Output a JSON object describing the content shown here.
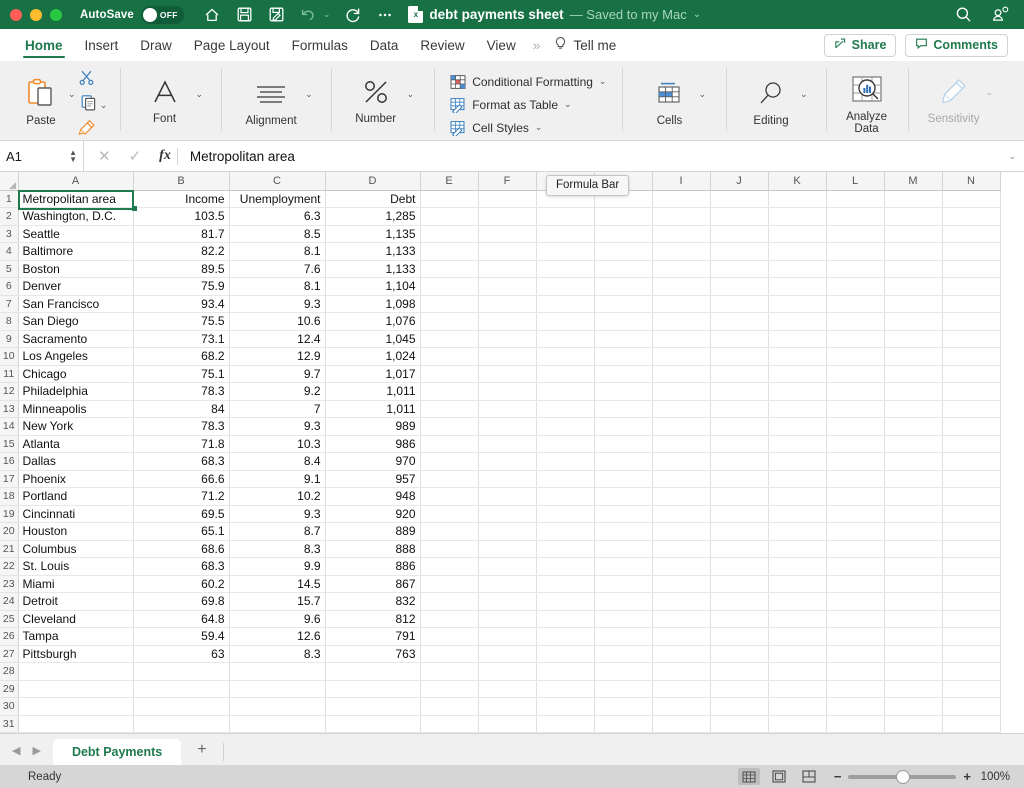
{
  "titlebar": {
    "autosave_label": "AutoSave",
    "autosave_state": "OFF",
    "doc_title": "debt payments sheet",
    "doc_status": "— Saved to my Mac",
    "icons": [
      "home-icon",
      "save-icon",
      "save-as-icon",
      "undo-icon",
      "redo-icon",
      "more-icon"
    ],
    "right_icons": [
      "search-icon",
      "collaborators-icon"
    ]
  },
  "ribbon_tabs": {
    "items": [
      {
        "label": "Home",
        "active": true
      },
      {
        "label": "Insert",
        "active": false
      },
      {
        "label": "Draw",
        "active": false
      },
      {
        "label": "Page Layout",
        "active": false
      },
      {
        "label": "Formulas",
        "active": false
      },
      {
        "label": "Data",
        "active": false
      },
      {
        "label": "Review",
        "active": false
      },
      {
        "label": "View",
        "active": false
      }
    ],
    "overflow": "»",
    "tell_me": "Tell me",
    "share_label": "Share",
    "comments_label": "Comments"
  },
  "ribbon": {
    "paste_label": "Paste",
    "font_label": "Font",
    "alignment_label": "Alignment",
    "number_label": "Number",
    "conditional_formatting_label": "Conditional Formatting",
    "format_as_table_label": "Format as Table",
    "cell_styles_label": "Cell Styles",
    "cells_label": "Cells",
    "editing_label": "Editing",
    "analyze_data_label": "Analyze Data",
    "analyze_data_line1": "Analyze",
    "analyze_data_line2": "Data",
    "sensitivity_label": "Sensitivity"
  },
  "formula_bar": {
    "name_box": "A1",
    "value": "Metropolitan area",
    "cancel_icon": "✕",
    "confirm_icon": "✓",
    "fx_icon": "fx"
  },
  "tooltip": {
    "text": "Formula Bar"
  },
  "grid": {
    "columns": [
      "A",
      "B",
      "C",
      "D",
      "E",
      "F",
      "G",
      "H",
      "I",
      "J",
      "K",
      "L",
      "M",
      "N"
    ],
    "row_numbers": [
      1,
      2,
      3,
      4,
      5,
      6,
      7,
      8,
      9,
      10,
      11,
      12,
      13,
      14,
      15,
      16,
      17,
      18,
      19,
      20,
      21,
      22,
      23,
      24,
      25,
      26,
      27,
      28,
      29,
      30,
      31
    ],
    "selected_cell": "A1",
    "headers": [
      "Metropolitan area",
      "Income",
      "Unemployment",
      "Debt"
    ],
    "rows": [
      {
        "area": "Washington, D.C.",
        "income": "103.5",
        "unemployment": "6.3",
        "debt": "1,285"
      },
      {
        "area": "Seattle",
        "income": "81.7",
        "unemployment": "8.5",
        "debt": "1,135"
      },
      {
        "area": "Baltimore",
        "income": "82.2",
        "unemployment": "8.1",
        "debt": "1,133"
      },
      {
        "area": "Boston",
        "income": "89.5",
        "unemployment": "7.6",
        "debt": "1,133"
      },
      {
        "area": "Denver",
        "income": "75.9",
        "unemployment": "8.1",
        "debt": "1,104"
      },
      {
        "area": "San Francisco",
        "income": "93.4",
        "unemployment": "9.3",
        "debt": "1,098"
      },
      {
        "area": "San Diego",
        "income": "75.5",
        "unemployment": "10.6",
        "debt": "1,076"
      },
      {
        "area": "Sacramento",
        "income": "73.1",
        "unemployment": "12.4",
        "debt": "1,045"
      },
      {
        "area": "Los Angeles",
        "income": "68.2",
        "unemployment": "12.9",
        "debt": "1,024"
      },
      {
        "area": "Chicago",
        "income": "75.1",
        "unemployment": "9.7",
        "debt": "1,017"
      },
      {
        "area": "Philadelphia",
        "income": "78.3",
        "unemployment": "9.2",
        "debt": "1,011"
      },
      {
        "area": "Minneapolis",
        "income": "84",
        "unemployment": "7",
        "debt": "1,011"
      },
      {
        "area": "New York",
        "income": "78.3",
        "unemployment": "9.3",
        "debt": "989"
      },
      {
        "area": "Atlanta",
        "income": "71.8",
        "unemployment": "10.3",
        "debt": "986"
      },
      {
        "area": "Dallas",
        "income": "68.3",
        "unemployment": "8.4",
        "debt": "970"
      },
      {
        "area": "Phoenix",
        "income": "66.6",
        "unemployment": "9.1",
        "debt": "957"
      },
      {
        "area": "Portland",
        "income": "71.2",
        "unemployment": "10.2",
        "debt": "948"
      },
      {
        "area": "Cincinnati",
        "income": "69.5",
        "unemployment": "9.3",
        "debt": "920"
      },
      {
        "area": "Houston",
        "income": "65.1",
        "unemployment": "8.7",
        "debt": "889"
      },
      {
        "area": "Columbus",
        "income": "68.6",
        "unemployment": "8.3",
        "debt": "888"
      },
      {
        "area": "St. Louis",
        "income": "68.3",
        "unemployment": "9.9",
        "debt": "886"
      },
      {
        "area": "Miami",
        "income": "60.2",
        "unemployment": "14.5",
        "debt": "867"
      },
      {
        "area": "Detroit",
        "income": "69.8",
        "unemployment": "15.7",
        "debt": "832"
      },
      {
        "area": "Cleveland",
        "income": "64.8",
        "unemployment": "9.6",
        "debt": "812"
      },
      {
        "area": "Tampa",
        "income": "59.4",
        "unemployment": "12.6",
        "debt": "791"
      },
      {
        "area": "Pittsburgh",
        "income": "63",
        "unemployment": "8.3",
        "debt": "763"
      }
    ]
  },
  "sheetbar": {
    "prev_icon": "◀",
    "next_icon": "▶",
    "tabs": [
      {
        "label": "Debt Payments",
        "active": true
      }
    ],
    "add_label": "+"
  },
  "statusbar": {
    "status": "Ready",
    "views": [
      "normal-view",
      "page-layout-view",
      "page-break-view"
    ],
    "zoom_minus": "−",
    "zoom_plus": "+",
    "zoom_value": "100%"
  },
  "colors": {
    "brand_green": "#177145",
    "accent_green": "#1f7a4d",
    "ribbon_bg": "#f0f0f0",
    "status_bg": "#d6d6d6"
  }
}
